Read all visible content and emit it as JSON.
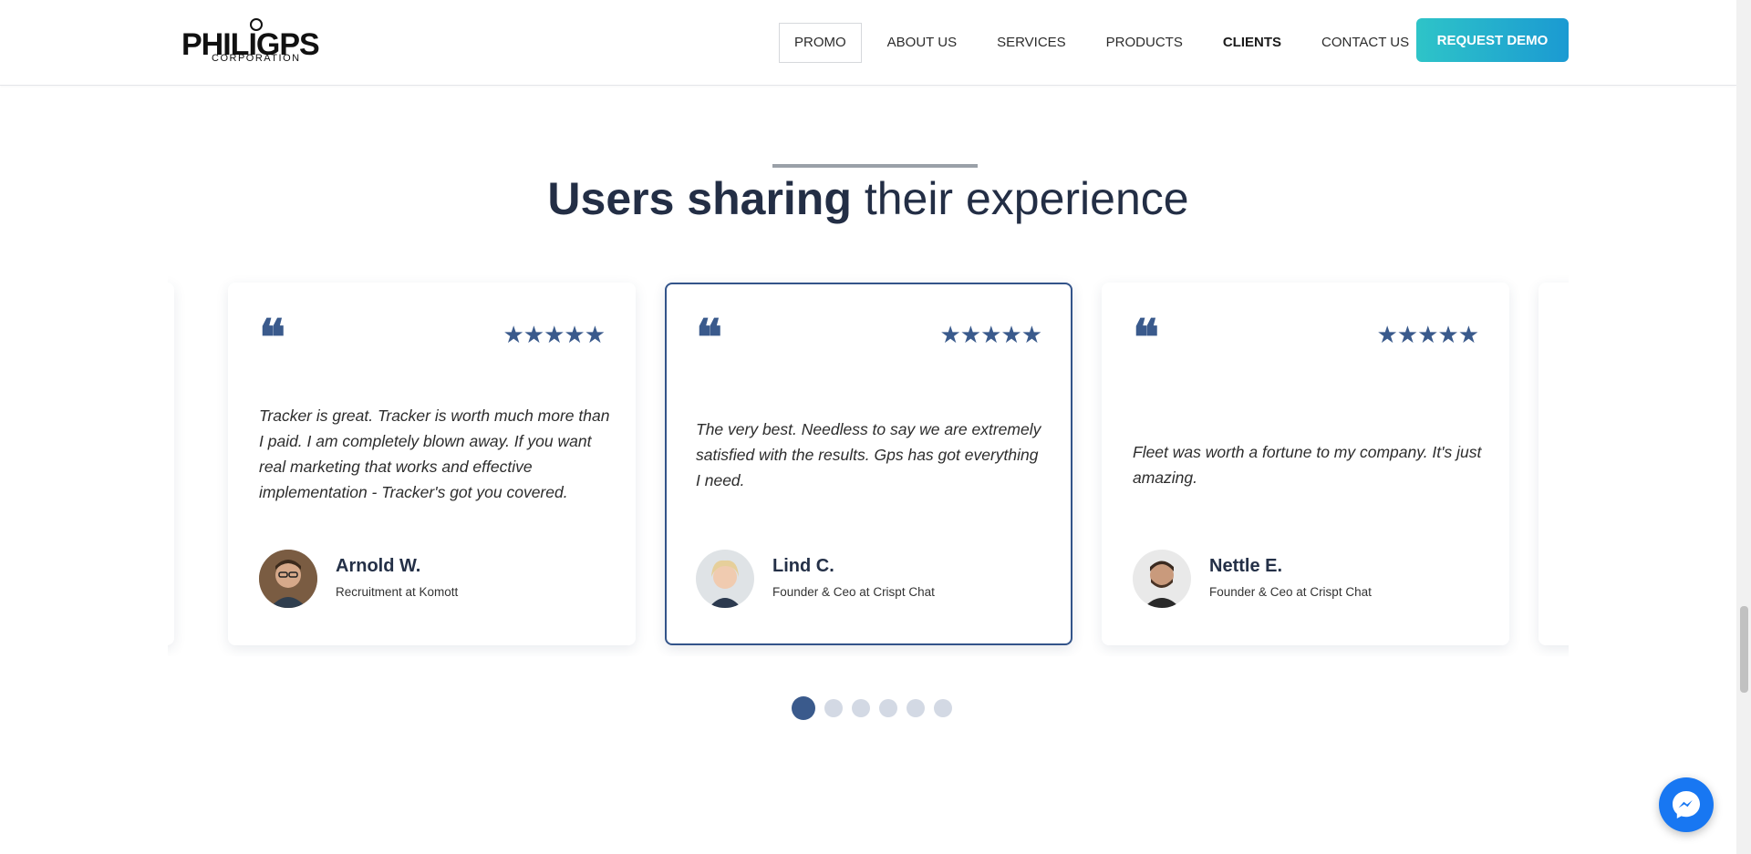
{
  "header": {
    "logo_main": "PHILIGPS",
    "logo_sub": "CORPORATION",
    "nav": [
      {
        "label": "PROMO"
      },
      {
        "label": "ABOUT US"
      },
      {
        "label": "SERVICES"
      },
      {
        "label": "PRODUCTS"
      },
      {
        "label": "CLIENTS"
      },
      {
        "label": "CONTACT US"
      }
    ],
    "active_nav": "PROMO",
    "cta_label": "REQUEST DEMO"
  },
  "section": {
    "heading_bold": "Users sharing",
    "heading_light": "their experience"
  },
  "testimonials": [
    {
      "quote": "Tracker is great. Tracker is worth much more than I paid. I am completely blown away. If you want real marketing that works and effective implementation - Tracker's got you covered.",
      "name": "Arnold W.",
      "role": "Recruitment at Komott",
      "stars": "★★★★★",
      "rating": 5
    },
    {
      "quote": "The very best. Needless to say we are extremely satisfied with the results. Gps has got everything I need.",
      "name": "Lind C.",
      "role": "Founder & Ceo at Crispt Chat",
      "stars": "★★★★★",
      "rating": 5
    },
    {
      "quote": "Fleet was worth a fortune to my company. It's just amazing.",
      "name": "Nettle E.",
      "role": "Founder & Ceo at Crispt Chat",
      "stars": "★★★★★",
      "rating": 5
    }
  ],
  "quote_glyph": "❝",
  "carousel": {
    "total_slides": 6,
    "active_slide": 1
  },
  "colors": {
    "accent": "#3a5a8c",
    "cta_gradient_start": "#2ec4c8",
    "cta_gradient_end": "#1b9ad2",
    "messenger": "#1877f2"
  },
  "icons": {
    "quote": "quote-icon",
    "star": "star-icon",
    "messenger": "messenger-icon"
  }
}
